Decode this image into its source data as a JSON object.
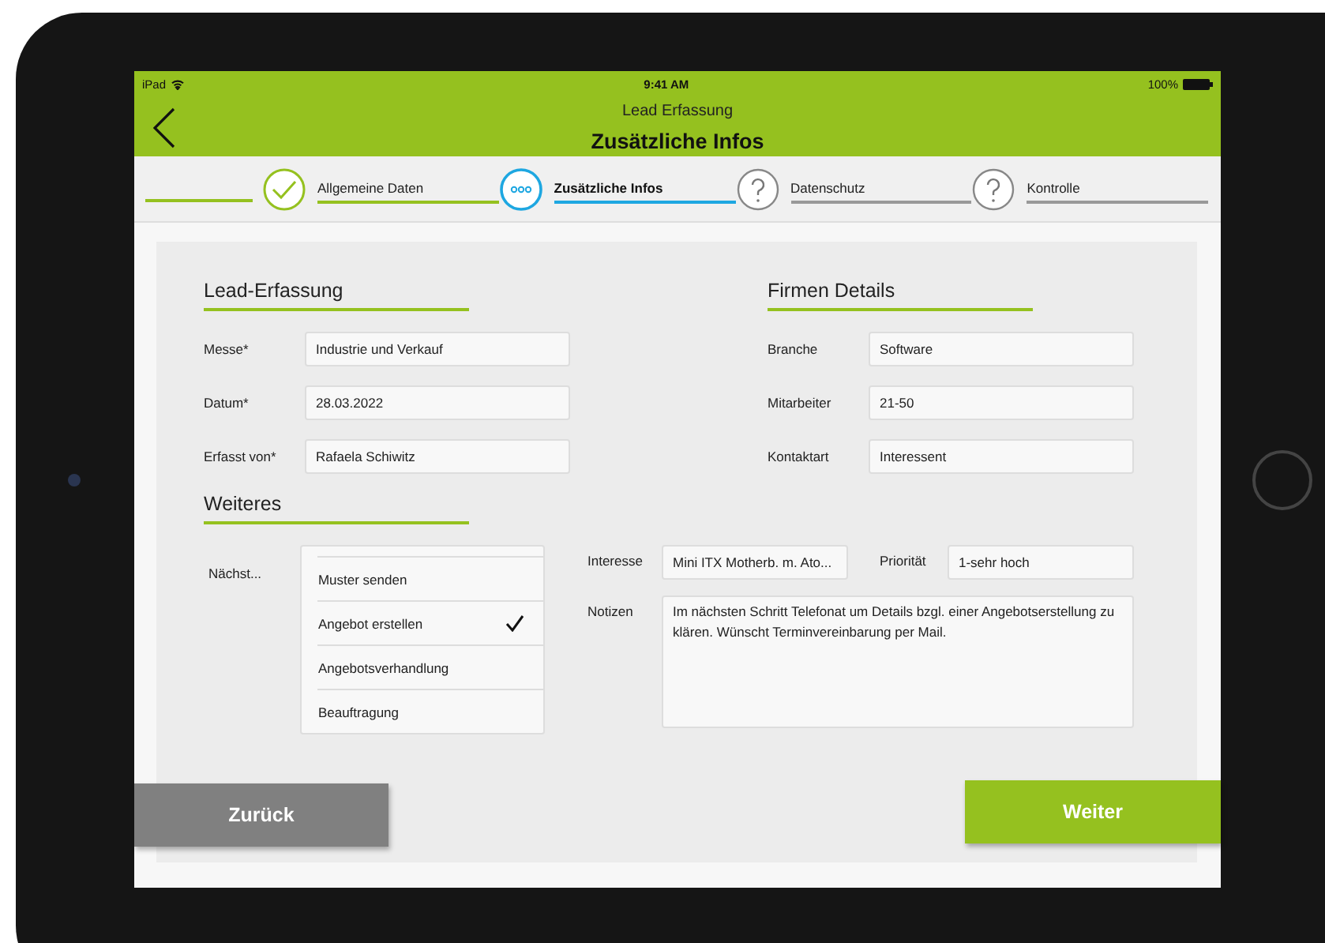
{
  "status_bar": {
    "device": "iPad",
    "time": "9:41 AM",
    "battery": "100%"
  },
  "header": {
    "subtitle": "Lead Erfassung",
    "title": "Zusätzliche Infos"
  },
  "steps": [
    {
      "label": "Allgemeine Daten",
      "kind": "done",
      "selected": false
    },
    {
      "label": "Zusätzliche Infos",
      "kind": "current",
      "selected": true
    },
    {
      "label": "Datenschutz",
      "kind": "pending",
      "selected": false
    },
    {
      "label": "Kontrolle",
      "kind": "pending",
      "selected": false
    }
  ],
  "lead_section": {
    "title": "Lead-Erfassung",
    "fields": [
      {
        "label": "Messe*",
        "value": "Industrie und Verkauf"
      },
      {
        "label": "Datum*",
        "value": "28.03.2022"
      },
      {
        "label": "Erfasst von*",
        "value": "Rafaela Schiwitz"
      }
    ]
  },
  "company_section": {
    "title": "Firmen Details",
    "fields": [
      {
        "label": "Branche",
        "value": "Software"
      },
      {
        "label": "Mitarbeiter",
        "value": "21-50"
      },
      {
        "label": "Kontaktart",
        "value": "Interessent"
      }
    ]
  },
  "more_section": {
    "title": "Weiteres",
    "next_step": {
      "label": "Nächst...",
      "options": [
        {
          "label": "Muster senden",
          "selected": false
        },
        {
          "label": "Angebot erstellen",
          "selected": true
        },
        {
          "label": "Angebotsverhandlung",
          "selected": false
        },
        {
          "label": "Beauftragung",
          "selected": false
        }
      ]
    },
    "interest": {
      "label": "Interesse",
      "value": "Mini ITX Motherb. m. Ato..."
    },
    "priority": {
      "label": "Priorität",
      "value": "1-sehr hoch"
    },
    "notes": {
      "label": "Notizen",
      "value": "Im nächsten Schritt Telefonat um Details bzgl. einer Angebotserstellung zu klären. Wünscht Terminvereinbarung per Mail."
    }
  },
  "buttons": {
    "back": "Zurück",
    "next": "Weiter"
  }
}
